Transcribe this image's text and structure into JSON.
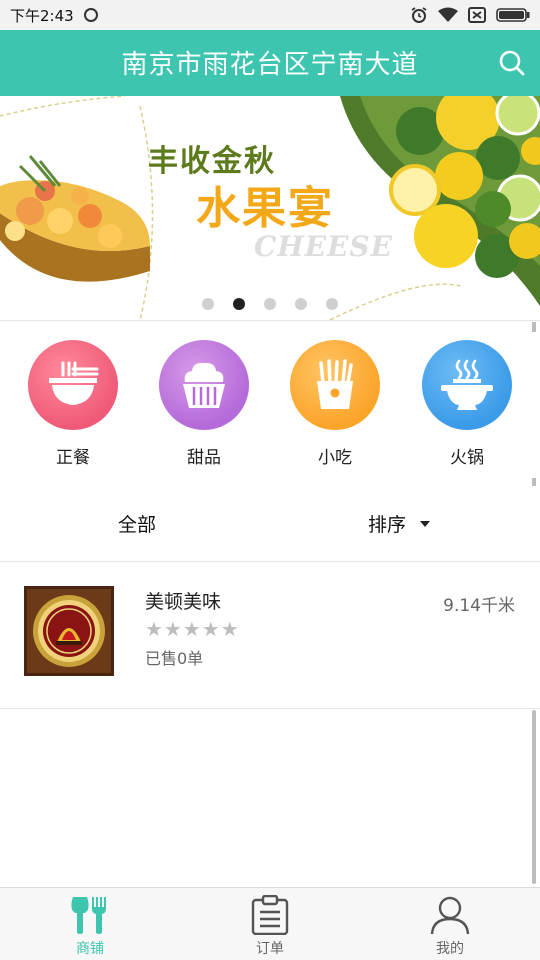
{
  "status_bar": {
    "time": "下午2:43"
  },
  "app_bar": {
    "title": "南京市雨花台区宁南大道",
    "search_icon": "search-icon"
  },
  "banner": {
    "title": "丰收金秋",
    "heading": "水果宴",
    "subtitle": "CHEESE",
    "dots": 5,
    "active_dot": 1
  },
  "categories": [
    {
      "label": "正餐",
      "icon": "rice-bowl-icon",
      "color": "#f05a78"
    },
    {
      "label": "甜品",
      "icon": "cupcake-icon",
      "color": "#b46ad9"
    },
    {
      "label": "小吃",
      "icon": "fries-icon",
      "color": "#fba42a"
    },
    {
      "label": "火锅",
      "icon": "hotpot-icon",
      "color": "#3b9be8"
    }
  ],
  "filters": {
    "all_label": "全部",
    "sort_label": "排序"
  },
  "shops": [
    {
      "name": "美顿美味",
      "distance": "9.14千米",
      "rating_text": "★★★★★",
      "rating": 0,
      "sold": "已售0单"
    }
  ],
  "bottom_nav": [
    {
      "label": "商铺",
      "icon": "utensils-icon",
      "active": true
    },
    {
      "label": "订单",
      "icon": "clipboard-icon",
      "active": false
    },
    {
      "label": "我的",
      "icon": "user-icon",
      "active": false
    }
  ],
  "colors": {
    "accent": "#3ec5b0",
    "status_bar": "#f2f2f2"
  }
}
